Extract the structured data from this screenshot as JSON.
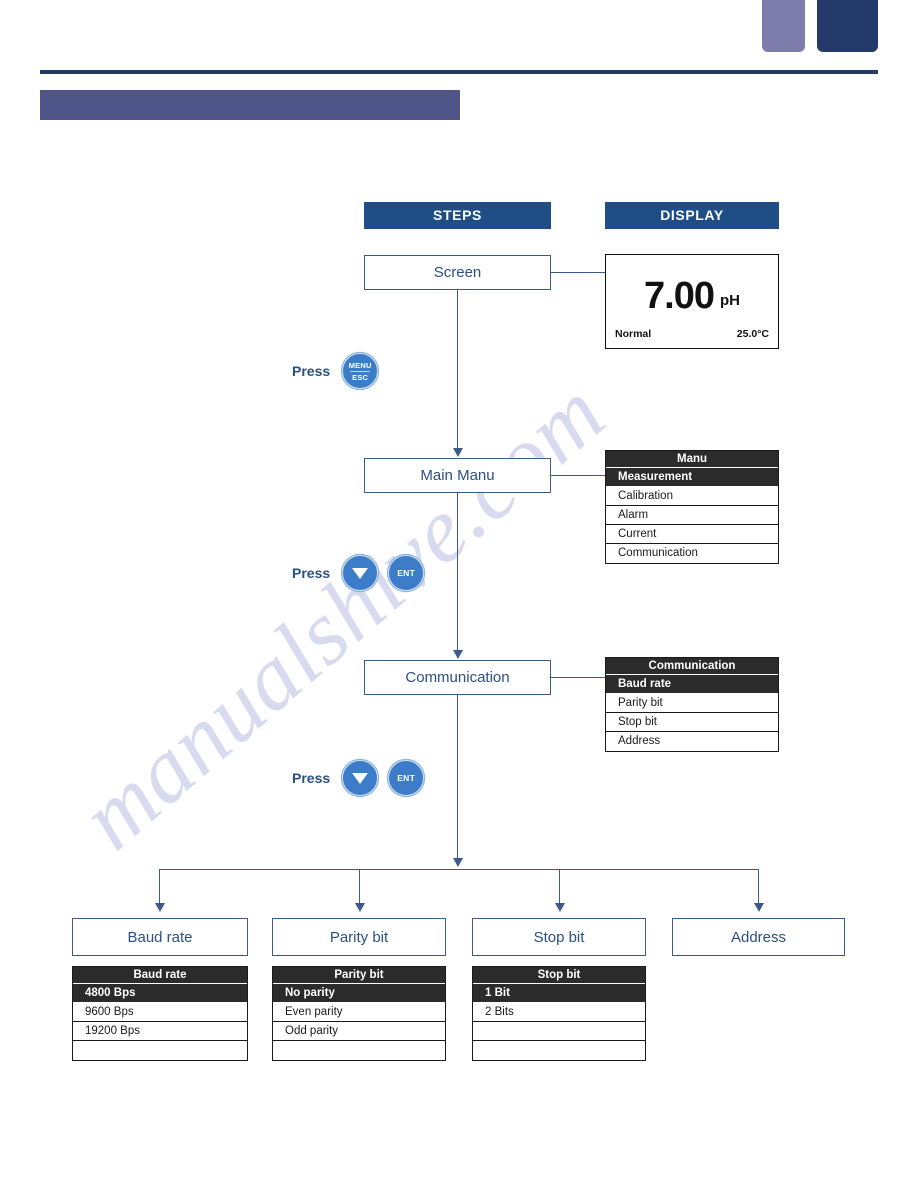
{
  "page": {
    "watermark": "manualshive.com",
    "title_band_text": ""
  },
  "columns": {
    "steps_label": "STEPS",
    "display_label": "DISPLAY"
  },
  "flow": {
    "screen_label": "Screen",
    "main_menu_label": "Main Manu",
    "communication_label": "Communication"
  },
  "press": {
    "label": "Press",
    "menu_btn_top": "MENU",
    "menu_btn_bottom": "ESC",
    "down_btn": "down-arrow",
    "ent_btn": "ENT"
  },
  "lcd": {
    "value": "7.00",
    "unit": "pH",
    "status": "Normal",
    "temperature": "25.0°C"
  },
  "menus": {
    "main": {
      "title": "Manu",
      "rows": [
        {
          "label": "Measurement",
          "selected": true
        },
        {
          "label": "Calibration",
          "selected": false
        },
        {
          "label": "Alarm",
          "selected": false
        },
        {
          "label": "Current",
          "selected": false
        },
        {
          "label": "Communication",
          "selected": false
        }
      ]
    },
    "communication": {
      "title": "Communication",
      "rows": [
        {
          "label": "Baud rate",
          "selected": true
        },
        {
          "label": "Parity bit",
          "selected": false
        },
        {
          "label": "Stop bit",
          "selected": false
        },
        {
          "label": "Address",
          "selected": false
        }
      ]
    },
    "baud_rate": {
      "title": "Baud rate",
      "rows": [
        {
          "label": "4800 Bps",
          "selected": true
        },
        {
          "label": "9600 Bps",
          "selected": false
        },
        {
          "label": "19200 Bps",
          "selected": false
        },
        {
          "label": "",
          "selected": false
        }
      ]
    },
    "parity_bit": {
      "title": "Parity bit",
      "rows": [
        {
          "label": "No parity",
          "selected": true
        },
        {
          "label": "Even parity",
          "selected": false
        },
        {
          "label": "Odd parity",
          "selected": false
        },
        {
          "label": "",
          "selected": false
        }
      ]
    },
    "stop_bit": {
      "title": "Stop bit",
      "rows": [
        {
          "label": "1 Bit",
          "selected": true
        },
        {
          "label": "2 Bits",
          "selected": false
        },
        {
          "label": "",
          "selected": false
        },
        {
          "label": "",
          "selected": false
        }
      ]
    }
  },
  "leaves": [
    {
      "label": "Baud rate"
    },
    {
      "label": "Parity bit"
    },
    {
      "label": "Stop bit"
    },
    {
      "label": "Address"
    }
  ],
  "colors": {
    "navy": "#253a6b",
    "band_purple": "#4f5489",
    "tab_light": "#7d7cab",
    "header_blue": "#1f4e87",
    "box_border": "#3c5b88",
    "box_text": "#2a5085",
    "menu_dark": "#2b2b2b",
    "button_blue": "#3d7cc9"
  }
}
